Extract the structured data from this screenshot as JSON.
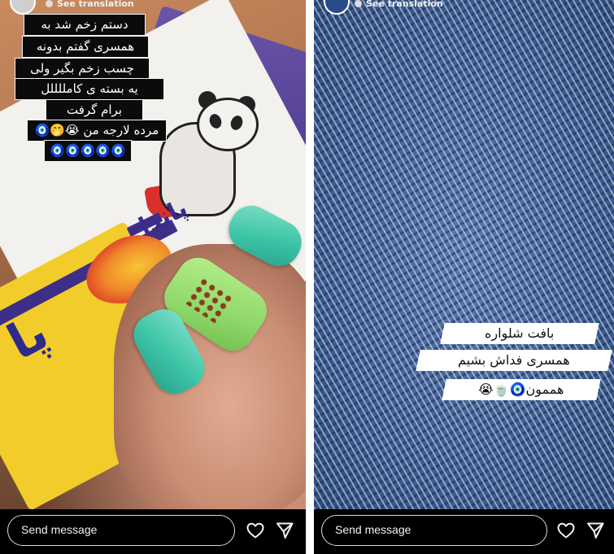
{
  "stories": [
    {
      "translation_link": "See translation",
      "caption_lines": [
        "دستم زخم شد به",
        "همسری گفتم بدونه",
        "چسب زخم بگیر ولی",
        "یه بسته ی کامللللل",
        "برام گرفت",
        "مرده لارجه من 😭🤭🧿",
        "🧿🧿🧿🧿🧿"
      ],
      "product_brand": "پاندا",
      "product_brand_large": "پا",
      "reply_placeholder": "Send message"
    },
    {
      "translation_link": "See translation",
      "caption_lines": [
        "بافت شلواره",
        "همسری فداش بشیم",
        "هممون🧿🍵😭"
      ],
      "reply_placeholder": "Send message"
    }
  ],
  "icons": {
    "like": "heart-icon",
    "share": "send-icon",
    "translate": "globe-icon"
  },
  "colors": {
    "caption_dark_bg": "#0b0b0b",
    "caption_light_bg": "#ffffff",
    "bar_bg": "#000000"
  }
}
